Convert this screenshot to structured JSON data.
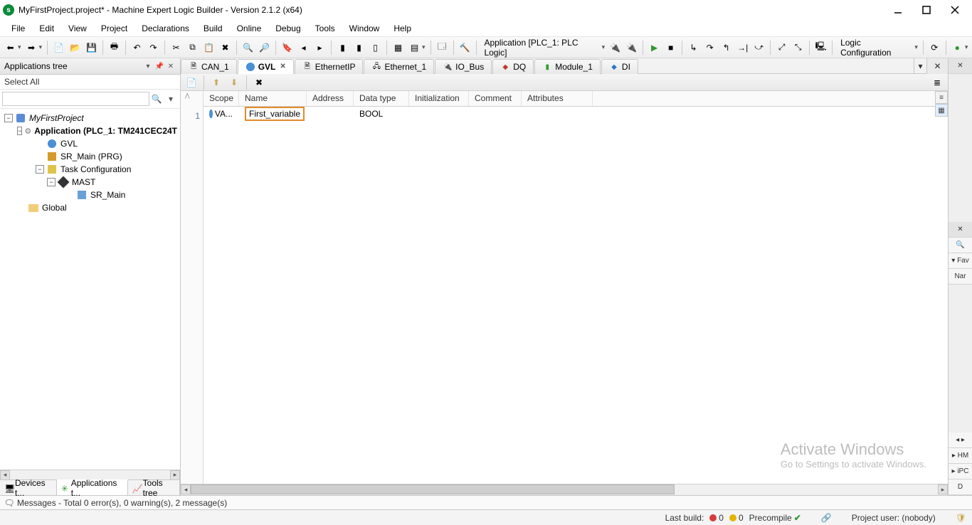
{
  "title": "MyFirstProject.project* - Machine Expert Logic Builder - Version 2.1.2 (x64)",
  "menu": [
    "File",
    "Edit",
    "View",
    "Project",
    "Declarations",
    "Build",
    "Online",
    "Debug",
    "Tools",
    "Window",
    "Help"
  ],
  "toolbar_context": "Application [PLC_1: PLC Logic]",
  "toolbar_right_label": "Logic Configuration",
  "left_panel": {
    "title": "Applications tree",
    "selector": "Select All",
    "tree": {
      "project": "MyFirstProject",
      "application": "Application (PLC_1: TM241CEC24T",
      "gvl": "GVL",
      "sr_main_prg": "SR_Main (PRG)",
      "task_cfg": "Task Configuration",
      "mast": "MAST",
      "sr_main": "SR_Main",
      "global": "Global"
    },
    "bottom_tabs": [
      "Devices t...",
      "Applications t...",
      "Tools tree"
    ]
  },
  "doc_tabs": [
    "CAN_1",
    "GVL",
    "EthernetIP",
    "Ethernet_1",
    "IO_Bus",
    "DQ",
    "Module_1",
    "DI"
  ],
  "grid": {
    "headers": [
      "Scope",
      "Name",
      "Address",
      "Data type",
      "Initialization",
      "Comment",
      "Attributes"
    ],
    "row1": {
      "line": "1",
      "scope": "VA...",
      "name": "First_variable",
      "datatype": "BOOL"
    }
  },
  "right_panel": {
    "fav": "▾ Fav",
    "nar": "Nar",
    "hm": "▸ HM",
    "ipc": "▸ iPC",
    "d": "D"
  },
  "watermark": {
    "l1": "Activate Windows",
    "l2": "Go to Settings to activate Windows."
  },
  "messages": "Messages - Total 0 error(s), 0 warning(s), 2 message(s)",
  "status": {
    "lastbuild": "Last build:",
    "err": "0",
    "warn": "0",
    "precompile": "Precompile",
    "project_user": "Project user: (nobody)"
  }
}
